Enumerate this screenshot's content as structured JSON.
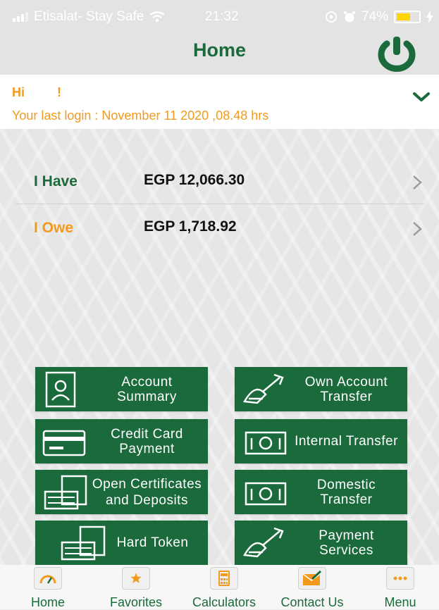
{
  "status_bar": {
    "carrier": "Etisalat- Stay Safe",
    "time": "21:32",
    "battery": "74%",
    "battery_level": 0.74
  },
  "header": {
    "title": "Home"
  },
  "greeting": {
    "hi": "Hi",
    "exclaim": "!",
    "last_login": "Your last login : November 11 2020 ,08.48 hrs"
  },
  "balances": [
    {
      "label": "I Have",
      "amount": "EGP 12,066.30",
      "color": "#1b6a3b"
    },
    {
      "label": "I Owe",
      "amount": "EGP 1,718.92",
      "color": "#f39a1e"
    }
  ],
  "tiles": [
    {
      "label": "Account Summary",
      "icon": "account-summary-icon"
    },
    {
      "label": "Own Account Transfer",
      "icon": "own-account-transfer-icon"
    },
    {
      "label": "Credit Card Payment",
      "icon": "credit-card-icon"
    },
    {
      "label": "Internal Transfer",
      "icon": "internal-transfer-icon"
    },
    {
      "label": "Open Certificates and Deposits",
      "icon": "certificates-icon"
    },
    {
      "label": "Domestic Transfer",
      "icon": "domestic-transfer-icon"
    },
    {
      "label": "Hard Token",
      "icon": "hard-token-icon"
    },
    {
      "label": "Payment Services",
      "icon": "payment-services-icon"
    }
  ],
  "bottom_nav": [
    {
      "label": "Home",
      "icon": "speedometer-icon"
    },
    {
      "label": "Favorites",
      "icon": "star-icon"
    },
    {
      "label": "Calculators",
      "icon": "calculator-icon"
    },
    {
      "label": "Contact Us",
      "icon": "envelope-icon"
    },
    {
      "label": "Menu",
      "icon": "more-dots-icon"
    }
  ],
  "colors": {
    "brand_green": "#1a6a3c",
    "accent_orange": "#f39a1e"
  }
}
